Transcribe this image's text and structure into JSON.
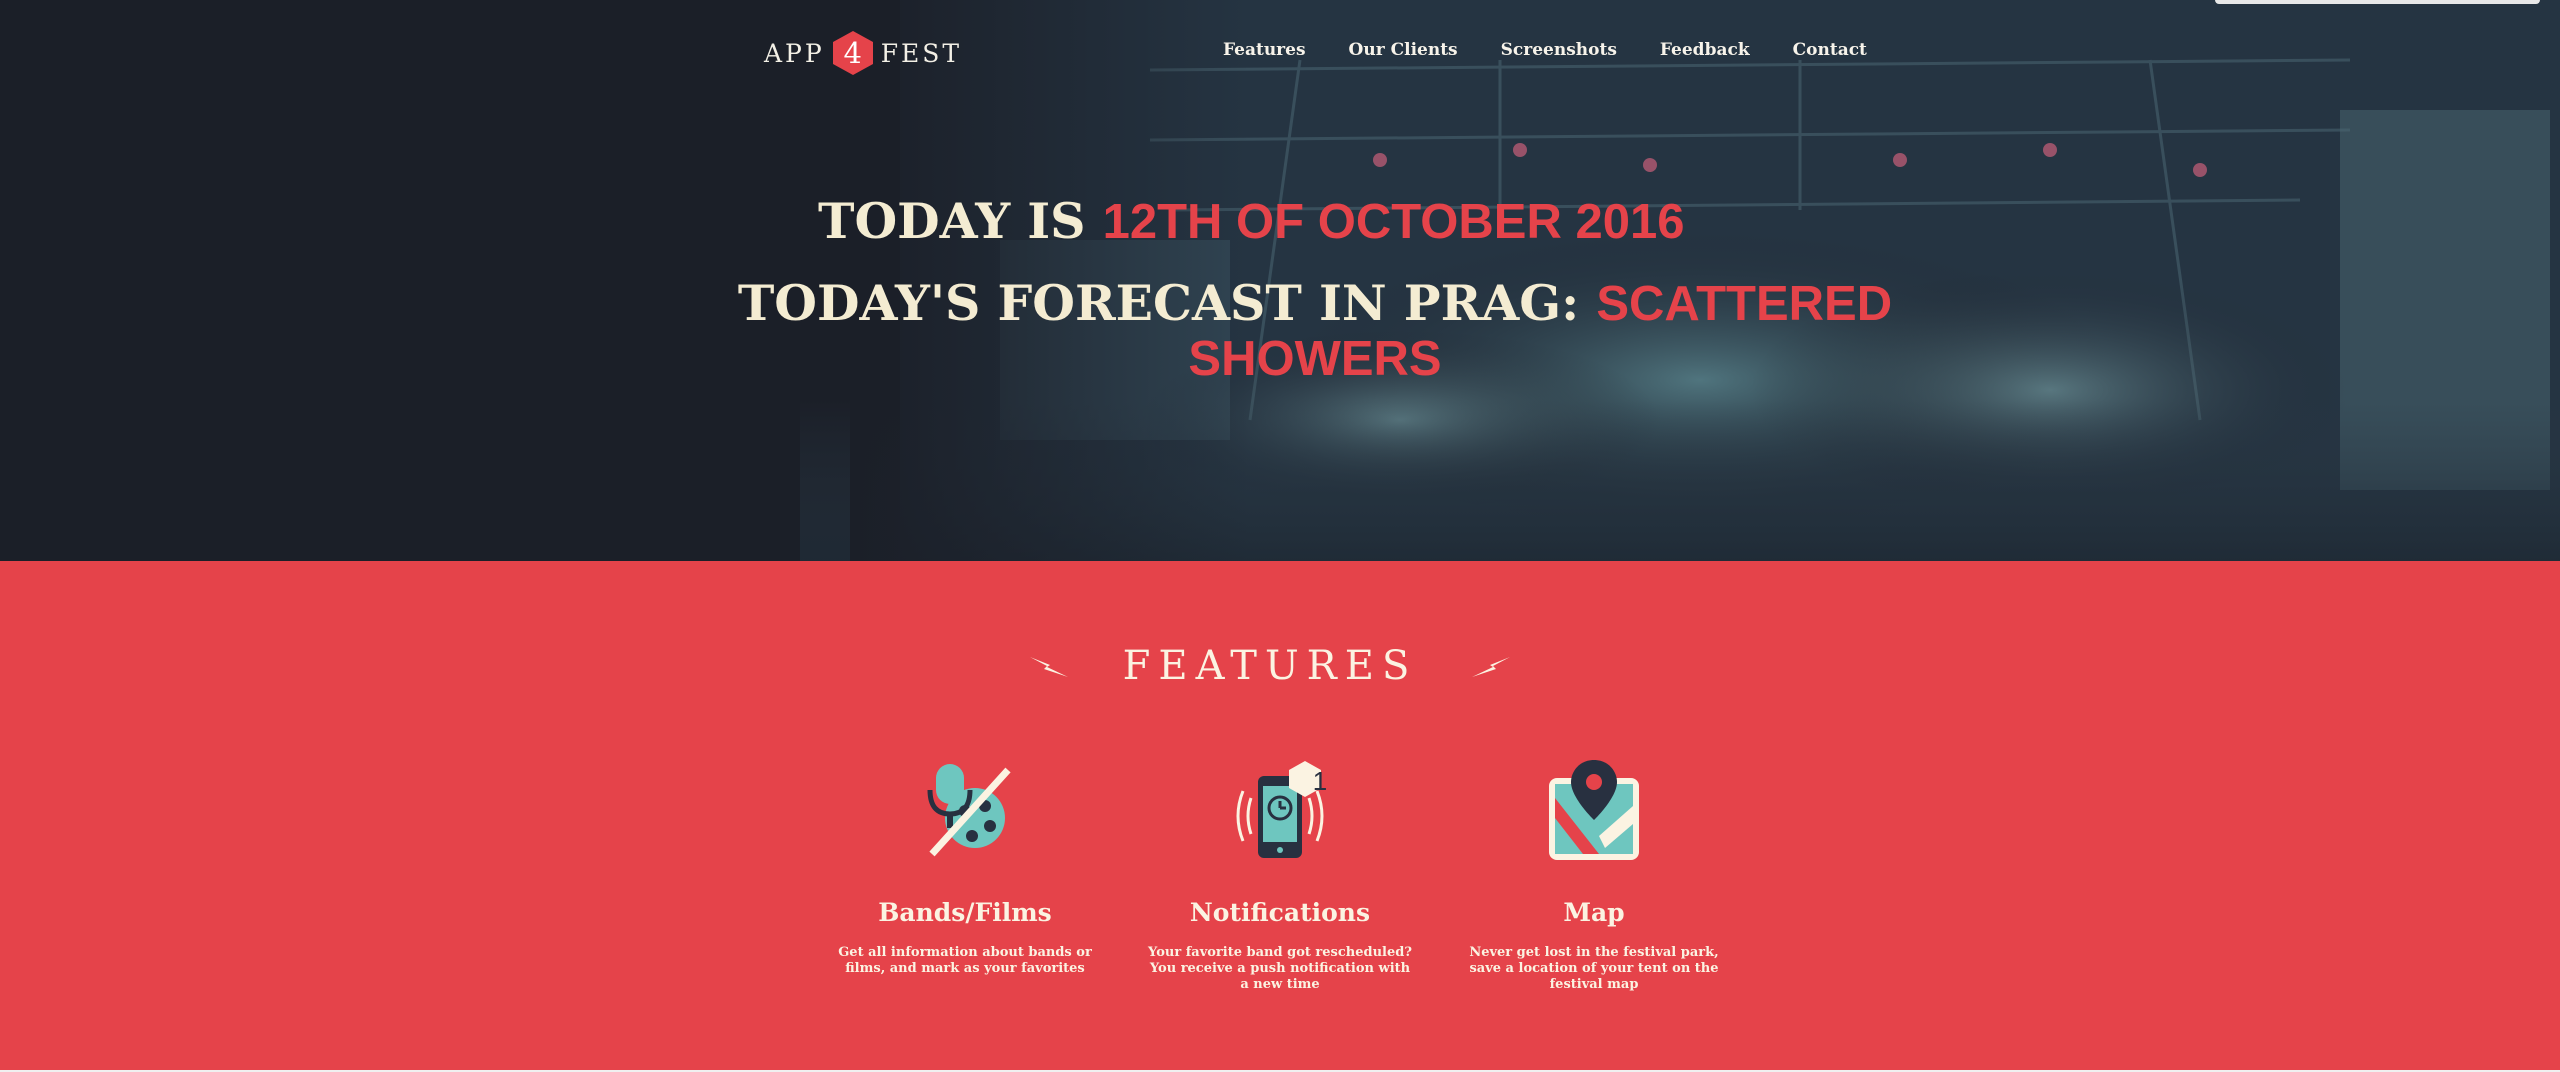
{
  "logo": {
    "left_word": "APP",
    "number": "4",
    "right_word": "FEST"
  },
  "nav": {
    "items": [
      {
        "label": "Features"
      },
      {
        "label": "Our Clients"
      },
      {
        "label": "Screenshots"
      },
      {
        "label": "Feedback"
      },
      {
        "label": "Contact"
      }
    ]
  },
  "hero": {
    "line1_prefix": "TODAY IS ",
    "line1_date": "12TH OF OCTOBER 2016",
    "line2_prefix": "TODAY'S FORECAST IN PRAG: ",
    "line2_forecast": "SCATTERED SHOWERS"
  },
  "features": {
    "title": "FEATURES",
    "items": [
      {
        "title": "Bands/Films",
        "description": "Get all information about bands or films, and mark as your favorites",
        "icon": "microphone-film-reel-icon"
      },
      {
        "title": "Notifications",
        "description": "Your favorite band got rescheduled? You receive a push notification with a new time",
        "icon": "phone-notification-icon",
        "badge": "1"
      },
      {
        "title": "Map",
        "description": "Never get lost in the festival park, save a location of your tent on the festival map",
        "icon": "map-pin-icon"
      }
    ]
  },
  "colors": {
    "accent": "#e5434a",
    "hero_bg": "#1b1f28",
    "cream": "#f4ecd2",
    "teal": "#6ec6bf"
  }
}
